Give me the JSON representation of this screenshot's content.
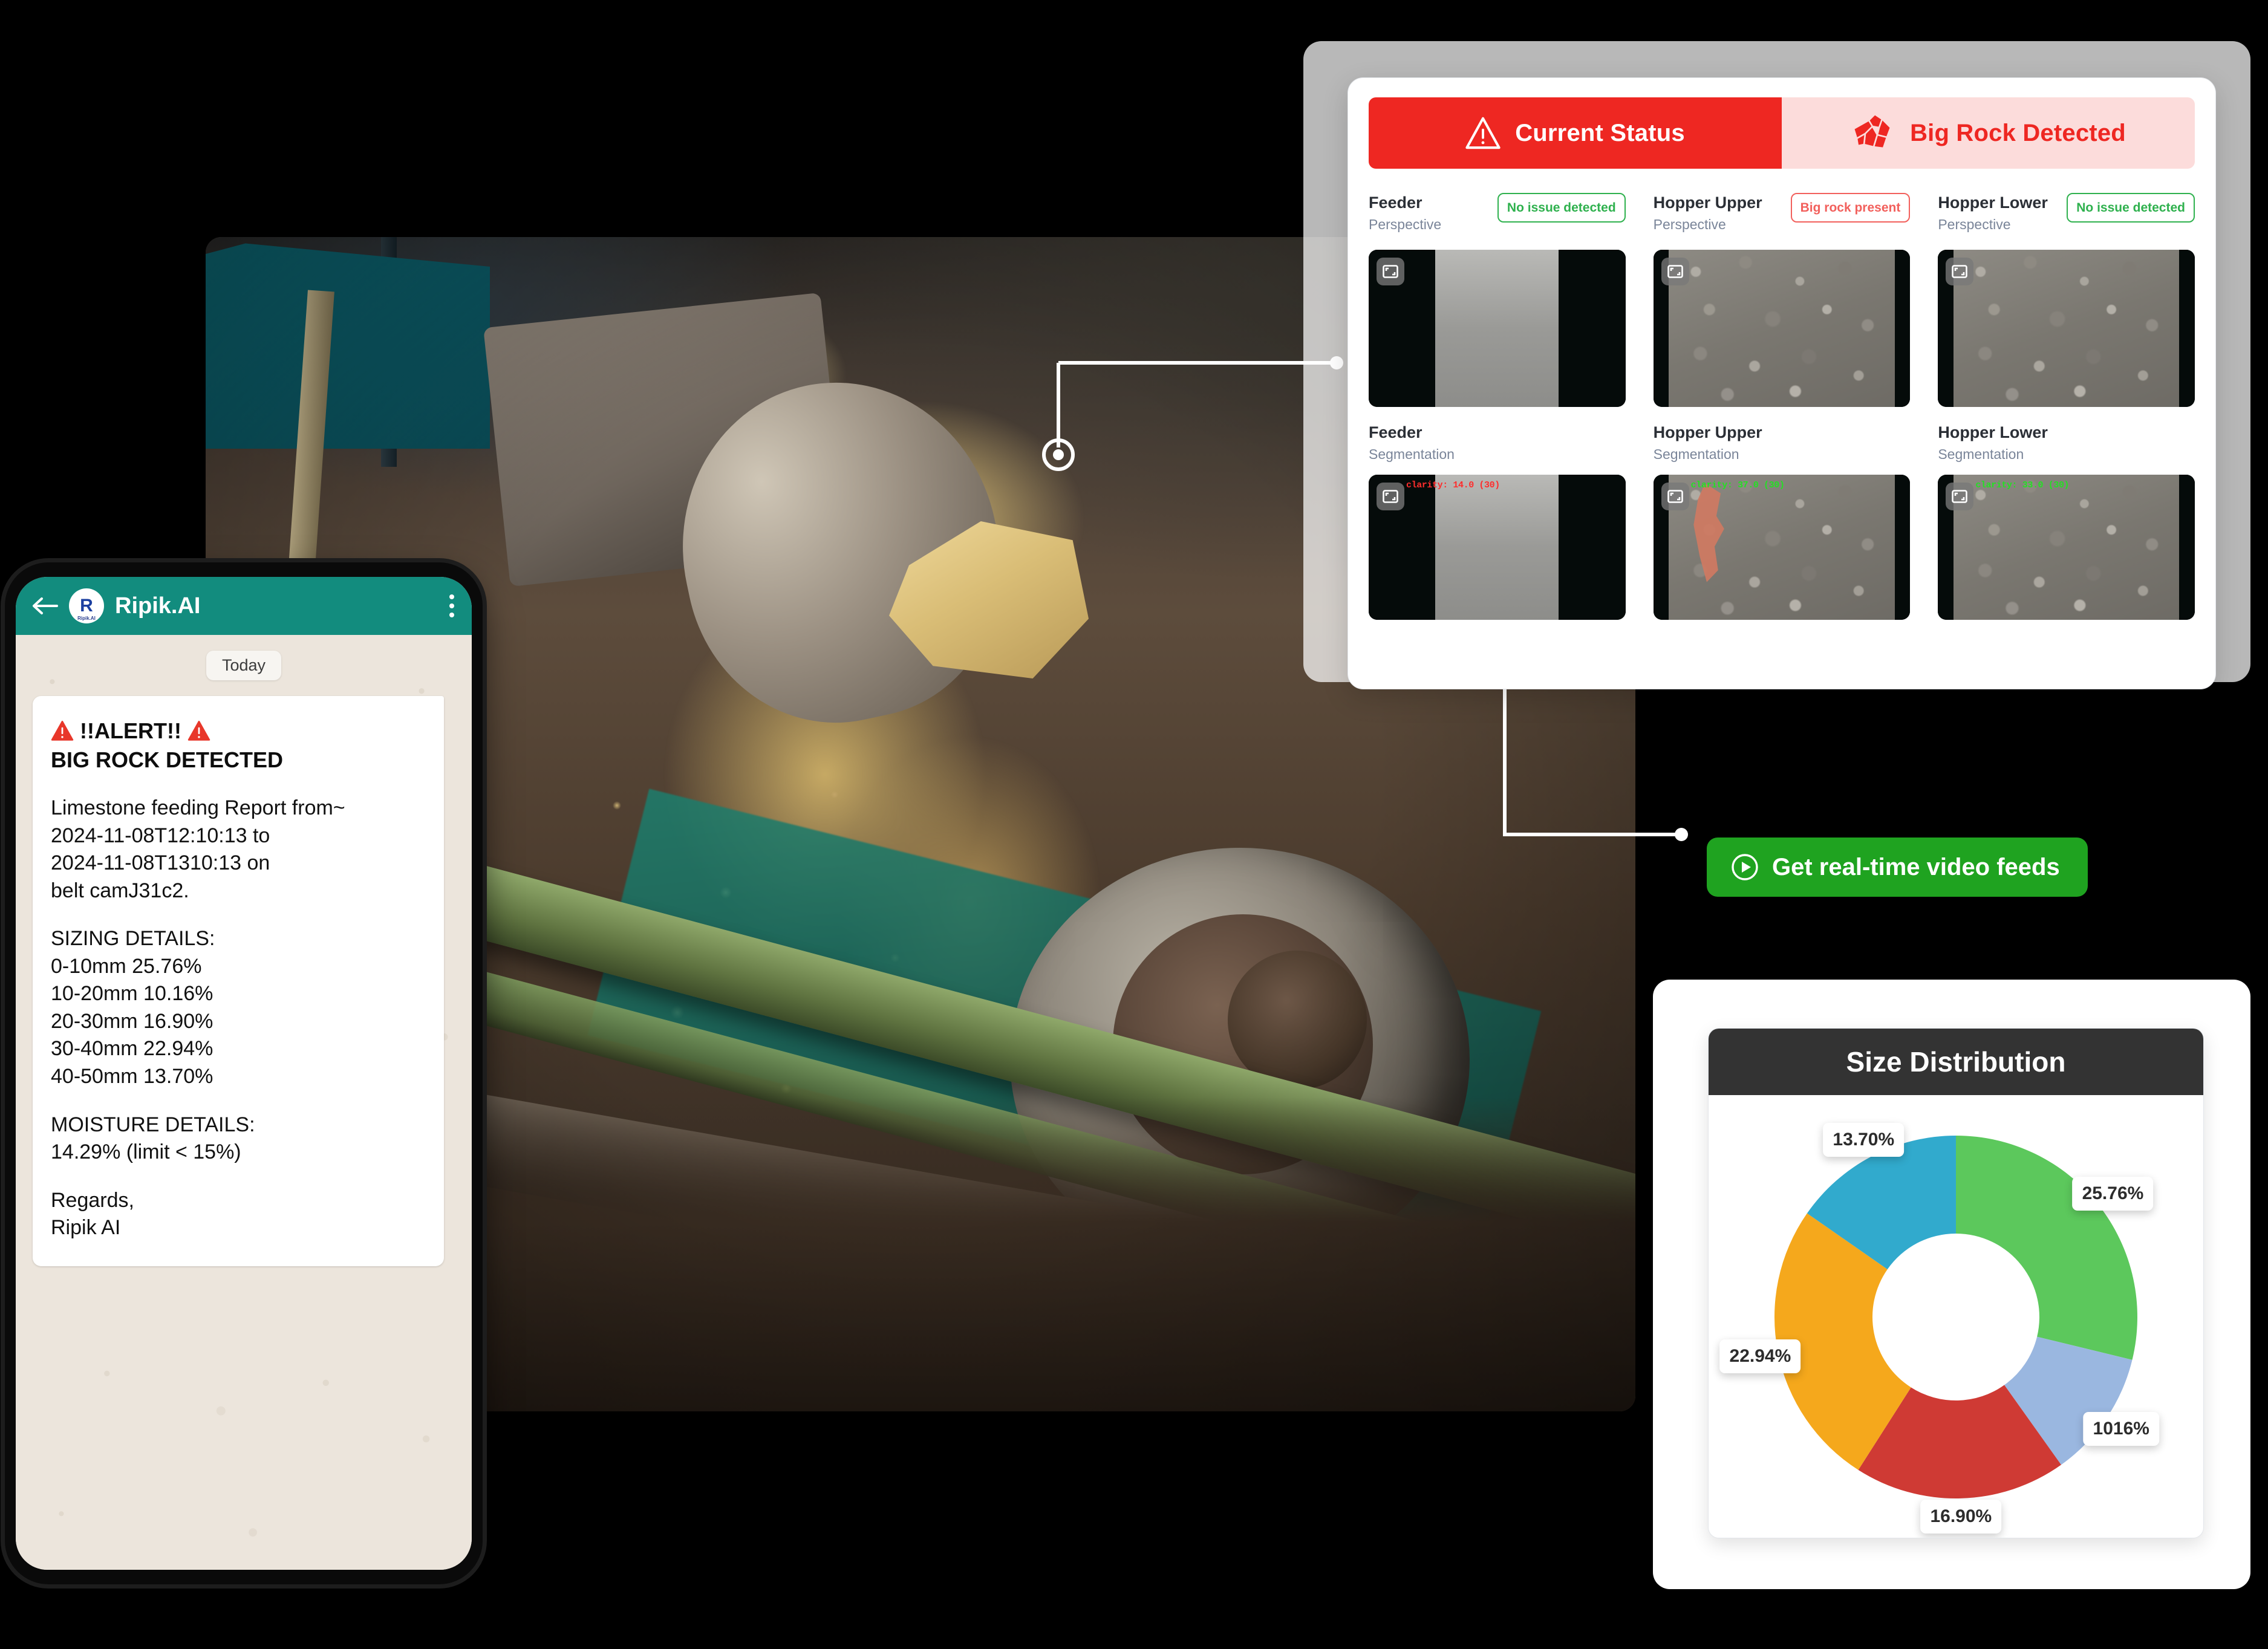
{
  "dashboard": {
    "status_banner": {
      "left_label": "Current Status",
      "left_icon": "warning-triangle-icon",
      "right_label": "Big Rock Detected",
      "right_icon": "rock-icon",
      "left_bg": "#ee2722",
      "right_bg": "#fcdcdb",
      "right_text_color": "#ee2722"
    },
    "cameras": [
      {
        "name": "Feeder",
        "view": "Perspective",
        "badge": "No issue detected",
        "badge_state": "ok",
        "tile_type": "belt",
        "overlay": ""
      },
      {
        "name": "Hopper Upper",
        "view": "Perspective",
        "badge": "Big rock present",
        "badge_state": "bad",
        "tile_type": "rock",
        "overlay": ""
      },
      {
        "name": "Hopper Lower",
        "view": "Perspective",
        "badge": "No issue detected",
        "badge_state": "ok",
        "tile_type": "rock",
        "overlay": ""
      }
    ],
    "segmentation": [
      {
        "name": "Feeder",
        "view": "Segmentation",
        "tile_type": "belt",
        "overlay": "clarity: 14.0 (30)",
        "overlay_color": "red"
      },
      {
        "name": "Hopper Upper",
        "view": "Segmentation",
        "tile_type": "rock",
        "overlay": "clarity: 37.0 (30)",
        "overlay_color": "green"
      },
      {
        "name": "Hopper Lower",
        "view": "Segmentation",
        "tile_type": "rock",
        "overlay": "clarity: 33.0 (30)",
        "overlay_color": "green"
      }
    ],
    "badge_colors": {
      "ok": "#2fb14e",
      "bad": "#f2605c"
    }
  },
  "cta": {
    "label": "Get real-time video feeds",
    "icon": "play-circle-icon",
    "bg": "#1fa320"
  },
  "phone": {
    "app_title": "Ripik.AI",
    "avatar_initial": "R",
    "avatar_sub": "Ripik.AI",
    "back_icon": "back-arrow-icon",
    "menu_icon": "overflow-menu-icon",
    "header_bg": "#128c7e",
    "date_divider": "Today",
    "message": {
      "alert_line": "!!ALERT!!",
      "alert_icon": "warning-triangle-icon",
      "headline": "BIG ROCK DETECTED",
      "body_lines": [
        "Limestone feeding Report from~",
        "2024-11-08T12:10:13 to",
        "2024-11-08T1310:13 on",
        "belt camJ31c2."
      ],
      "sizing_header": "SIZING DETAILS:",
      "sizing_lines": [
        "0-10mm 25.76%",
        "10-20mm 10.16%",
        "20-30mm 16.90%",
        "30-40mm 22.94%",
        "40-50mm 13.70%"
      ],
      "moisture_header": "MOISTURE DETAILS:",
      "moisture_line": "14.29% (limit < 15%)",
      "sign_off": "Regards,",
      "sign_name": "Ripik AI"
    }
  },
  "chart_card": {
    "title": "Size Distribution",
    "title_bg": "#333333"
  },
  "chart_data": {
    "type": "pie",
    "title": "Size Distribution",
    "subtitle": "",
    "xlabel": "",
    "ylabel": "",
    "legend_position": "none",
    "grid": false,
    "donut": true,
    "inner_radius_ratio": 0.46,
    "start_angle_deg": 0,
    "categories": [
      "0-10mm",
      "10-20mm",
      "20-30mm",
      "30-40mm",
      "40-50mm"
    ],
    "values": [
      25.76,
      10.16,
      16.9,
      22.94,
      13.7
    ],
    "labels": [
      "25.76%",
      "1016%",
      "16.90%",
      "22.94%",
      "13.70%"
    ],
    "colors": [
      "#5cc85c",
      "#9ab7e0",
      "#cf3a34",
      "#f5a81c",
      "#31aacd"
    ],
    "units": "%"
  }
}
